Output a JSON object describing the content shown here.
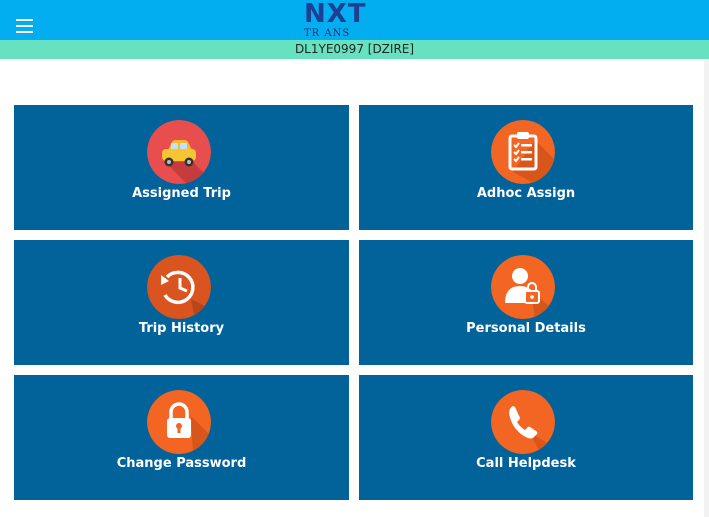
{
  "header": {
    "menu_icon": "hamburger-menu-icon",
    "logo_top": "NXT",
    "logo_bottom": "TR  ANS",
    "background_color": "#03aef0"
  },
  "vehicle": {
    "label": "DL1YE0997 [DZIRE]",
    "background_color": "#66e2c1"
  },
  "tiles": [
    {
      "label": "Assigned Trip",
      "icon": "car-icon",
      "icon_color": "#e94e4e"
    },
    {
      "label": "Adhoc Assign",
      "icon": "clipboard-checklist-icon",
      "icon_color": "#f26522"
    },
    {
      "label": "Trip History",
      "icon": "history-clock-icon",
      "icon_color": "#d9541e"
    },
    {
      "label": "Personal Details",
      "icon": "user-lock-icon",
      "icon_color": "#f26522"
    },
    {
      "label": "Change Password",
      "icon": "padlock-icon",
      "icon_color": "#f26522"
    },
    {
      "label": "Call Helpdesk",
      "icon": "phone-icon",
      "icon_color": "#f26522"
    }
  ],
  "tile_color": "#02639a"
}
